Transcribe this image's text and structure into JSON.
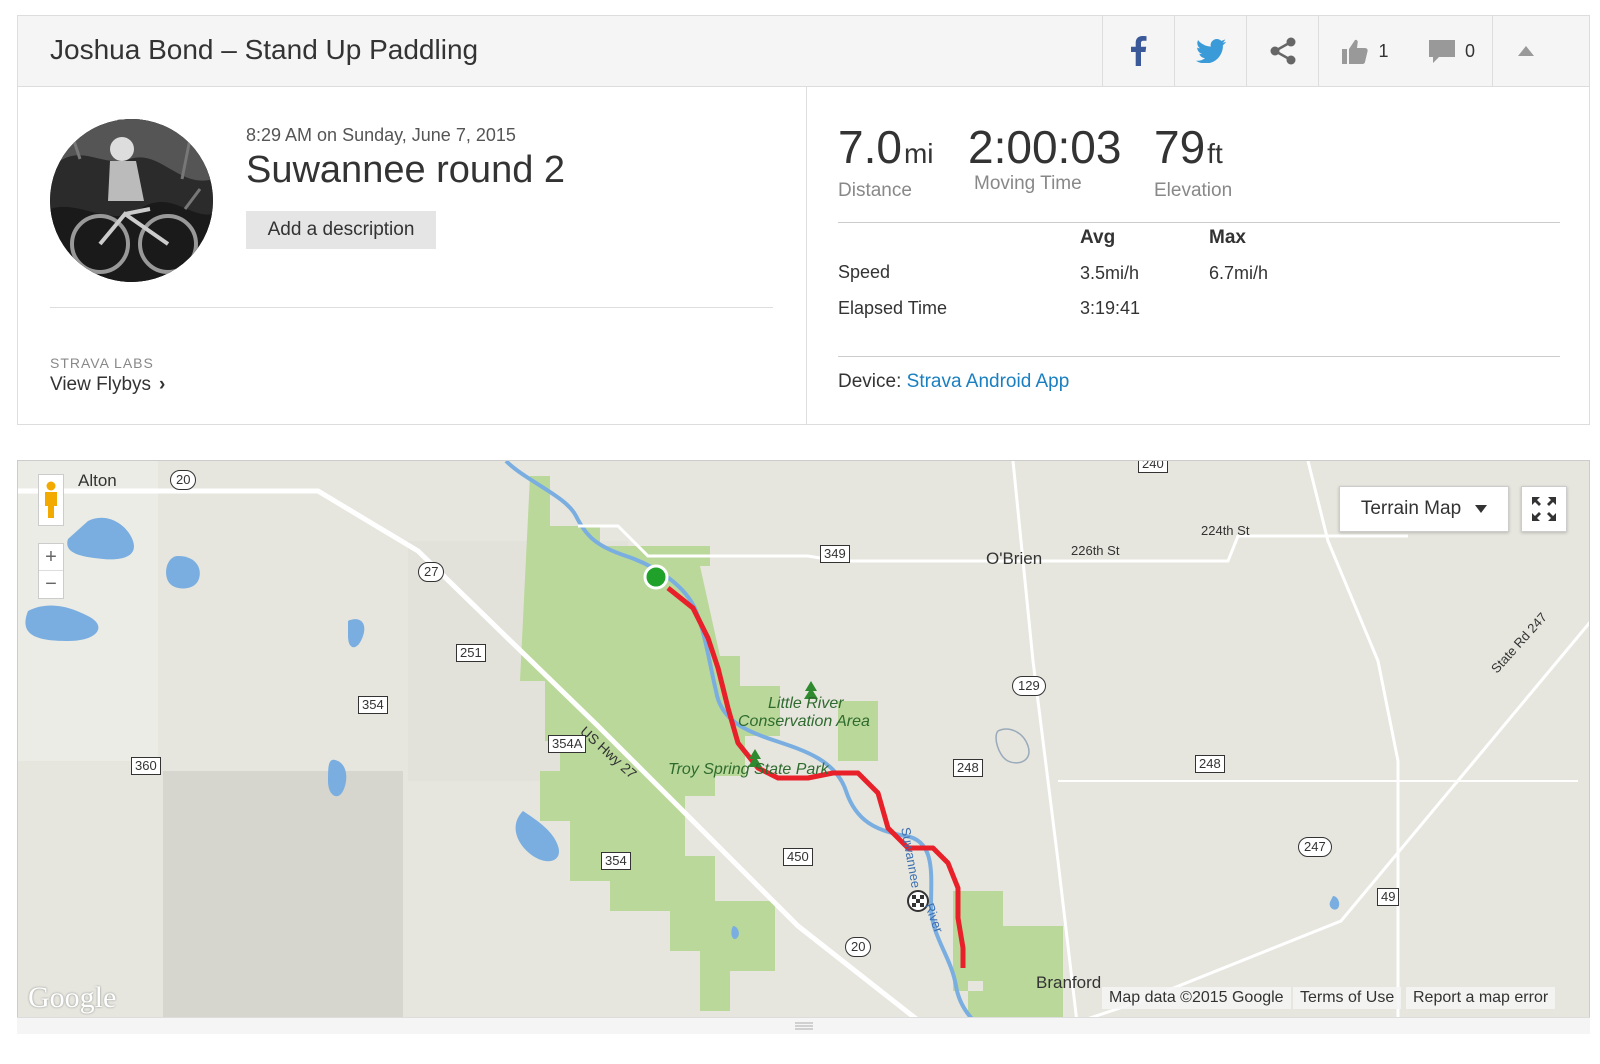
{
  "header": {
    "title": "Joshua Bond – Stand Up Paddling",
    "kudos_count": "1",
    "comment_count": "0"
  },
  "activity": {
    "date": "8:29 AM on Sunday, June 7, 2015",
    "name": "Suwannee round 2",
    "add_description_label": "Add a description"
  },
  "labs": {
    "label": "STRAVA LABS",
    "flybys_label": "View Flybys"
  },
  "stats": {
    "distance": {
      "value": "7.0",
      "unit": "mi",
      "label": "Distance"
    },
    "moving_time": {
      "value": "2:00:03",
      "label": "Moving Time"
    },
    "elevation": {
      "value": "79",
      "unit": "ft",
      "label": "Elevation"
    }
  },
  "table": {
    "avg_header": "Avg",
    "max_header": "Max",
    "rows": [
      {
        "label": "Speed",
        "avg": "3.5mi/h",
        "max": "6.7mi/h"
      },
      {
        "label": "Elapsed Time",
        "avg": "3:19:41",
        "max": ""
      }
    ]
  },
  "device": {
    "label": "Device:",
    "name": "Strava Android App"
  },
  "map": {
    "terrain_label": "Terrain Map",
    "places": {
      "alton": "Alton",
      "obrien": "O'Brien",
      "branford": "Branford",
      "little_river": "Little River",
      "conservation": "Conservation Area",
      "troy_spring": "Troy Spring State Park",
      "us_hwy_27": "US Hwy 27",
      "st_224": "224th St",
      "st_226": "226th St",
      "state_rd_247": "State Rd 247",
      "river_1": "Suwannee",
      "river_2": "River"
    },
    "shields": {
      "r20a": "20",
      "r27": "27",
      "r349": "349",
      "r251": "251",
      "r354a": "354",
      "r354A": "354A",
      "r360": "360",
      "r354b": "354",
      "r450": "450",
      "r20b": "20",
      "r248a": "248",
      "r248b": "248",
      "r129": "129",
      "r247": "247",
      "r49": "49",
      "r240": "240"
    },
    "logo": "Google",
    "attribution": {
      "data": "Map data ©2015 Google",
      "terms": "Terms of Use",
      "report": "Report a map error"
    },
    "colors": {
      "route": "#e8202a",
      "start": "#1fa12a",
      "park": "#bad89a",
      "water": "#7aaee0"
    }
  }
}
